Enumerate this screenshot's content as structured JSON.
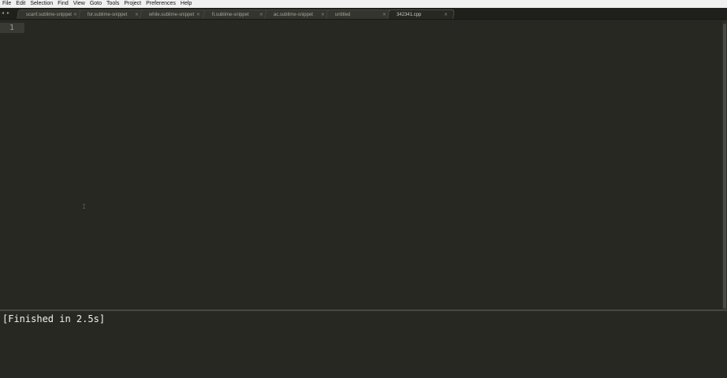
{
  "menubar": {
    "items": [
      "File",
      "Edit",
      "Selection",
      "Find",
      "View",
      "Goto",
      "Tools",
      "Project",
      "Preferences",
      "Help"
    ]
  },
  "tabs": {
    "nav_arrows": "◂ ▸",
    "items": [
      {
        "label": "scanf.sublime-snippet",
        "close": "×",
        "active": false
      },
      {
        "label": "for.sublime-snippet",
        "close": "×",
        "active": false
      },
      {
        "label": "while.sublime-snippet",
        "close": "×",
        "active": false
      },
      {
        "label": "fi.sublime-snippet",
        "close": "×",
        "active": false
      },
      {
        "label": "ac.sublime-snippet",
        "close": "×",
        "active": false
      },
      {
        "label": "untitled",
        "close": "×",
        "active": false
      },
      {
        "label": "342341.cpp",
        "close": "×",
        "active": true
      }
    ]
  },
  "editor": {
    "line_numbers": [
      "1"
    ],
    "cursor_glyph": "I"
  },
  "output": {
    "text": "[Finished in 2.5s]"
  },
  "colors": {
    "background": "#272822",
    "menubar": "#f0f0f0",
    "tabstrip": "#1f1f1c",
    "output_text": "#f2f2ec"
  }
}
